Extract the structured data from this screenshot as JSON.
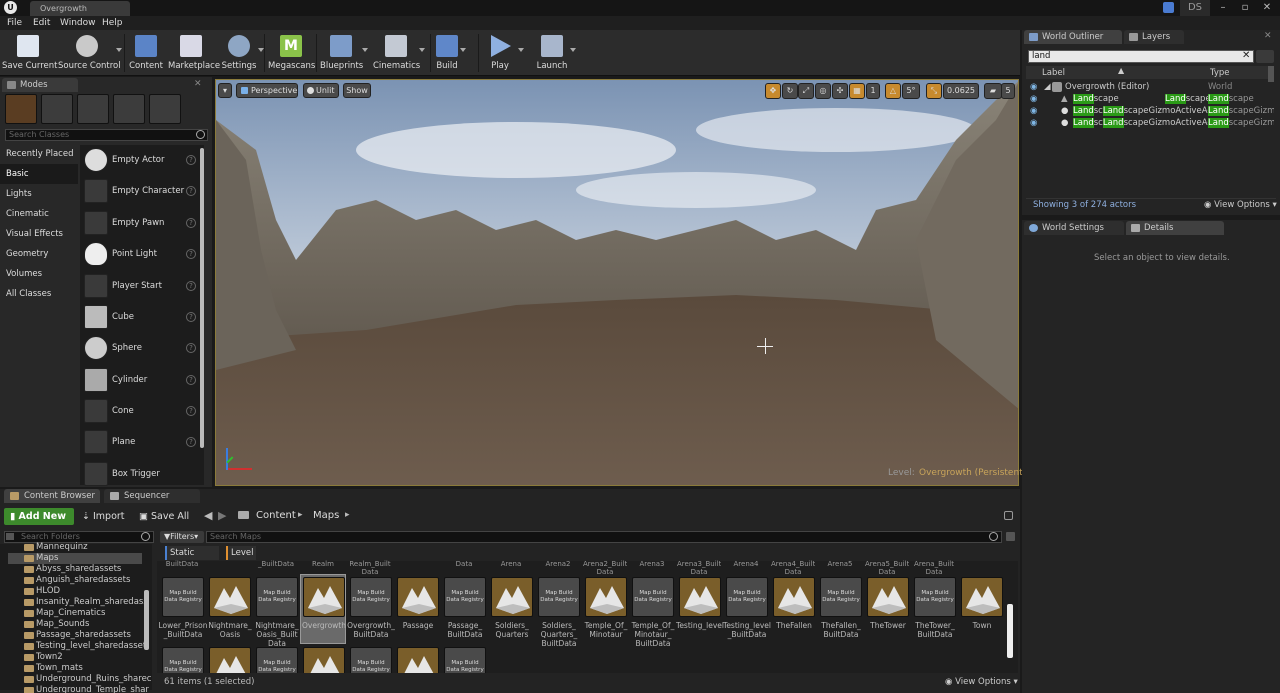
{
  "window": {
    "tab_title": "Overgrowth",
    "user_badge": "DS",
    "logo": "U"
  },
  "menu": [
    "File",
    "Edit",
    "Window",
    "Help"
  ],
  "toolbar": {
    "items": [
      {
        "label": "Save Current",
        "icon": "save-icon"
      },
      {
        "label": "Source Control",
        "icon": "source-control-icon"
      },
      {
        "label": "Content",
        "icon": "content-icon"
      },
      {
        "label": "Marketplace",
        "icon": "marketplace-icon"
      },
      {
        "label": "Settings",
        "icon": "settings-icon"
      },
      {
        "label": "Megascans",
        "icon": "megascans-icon"
      },
      {
        "label": "Blueprints",
        "icon": "blueprints-icon"
      },
      {
        "label": "Cinematics",
        "icon": "cinematics-icon"
      },
      {
        "label": "Build",
        "icon": "build-icon"
      },
      {
        "label": "Play",
        "icon": "play-icon"
      },
      {
        "label": "Launch",
        "icon": "launch-icon"
      }
    ]
  },
  "modes": {
    "tab": "Modes",
    "search_placeholder": "Search Classes",
    "categories": [
      "Recently Placed",
      "Basic",
      "Lights",
      "Cinematic",
      "Visual Effects",
      "Geometry",
      "Volumes",
      "All Classes"
    ],
    "selected_category": "Basic",
    "items": [
      "Empty Actor",
      "Empty Character",
      "Empty Pawn",
      "Point Light",
      "Player Start",
      "Cube",
      "Sphere",
      "Cylinder",
      "Cone",
      "Plane",
      "Box Trigger"
    ]
  },
  "viewport": {
    "perspective": "Perspective",
    "lit": "Unlit",
    "show": "Show",
    "grid_snap": "1",
    "rotation_snap": "5°",
    "scale_snap": "0.0625",
    "camera_speed": "5",
    "level_label": "Level:",
    "level_name": "Overgrowth (Persistent)"
  },
  "outliner": {
    "tabs": [
      "World Outliner",
      "Layers"
    ],
    "search_value": "land",
    "col_label": "Label",
    "col_type": "Type",
    "rows": [
      {
        "label": "Overgrowth (Editor)",
        "type": "World"
      },
      {
        "pre": "",
        "hl": "Land",
        "post": "scape",
        "type_hl": "Land",
        "type": "Landscape",
        "type_rest": "scape"
      },
      {
        "pre": "",
        "hl": "Land",
        "post": "sc",
        "hl2": "Land",
        "post2": "scapeGizmoActiveActor",
        "type_hl": "Land",
        "type_rest": "scapeGizmo"
      },
      {
        "pre": "",
        "hl": "Land",
        "post": "sc",
        "hl2": "Land",
        "post2": "scapeGizmoActiveActor",
        "type_hl": "Land",
        "type_rest": "scapeGizmo"
      }
    ],
    "status": "Showing 3 of 274 actors",
    "view_options": "View Options"
  },
  "details": {
    "tabs": [
      "World Settings",
      "Details"
    ],
    "empty_message": "Select an object to view details."
  },
  "content_browser": {
    "tabs": [
      "Content Browser",
      "Sequencer"
    ],
    "add_new": "Add New",
    "import": "Import",
    "save_all": "Save All",
    "path": [
      "Content",
      "Maps"
    ],
    "search_folders_placeholder": "Search Folders",
    "filters": "Filters",
    "search_maps_placeholder": "Search Maps",
    "filter_chips": [
      "Static Mesh",
      "Level"
    ],
    "folders": [
      "Mannequinz",
      "Maps",
      "Abyss_sharedassets",
      "Anguish_sharedassets",
      "HLOD",
      "Insanity_Realm_sharedass",
      "Map_Cinematics",
      "Map_Sounds",
      "Passage_sharedassets",
      "Testing_level_sharedasset",
      "Town2",
      "Town_mats",
      "Underground_Ruins_sharec",
      "Underground_Temple_shar"
    ],
    "top_row_clipped": [
      "BuiltData",
      "",
      "_BuiltData",
      "Realm",
      "Realm_Built Data",
      "",
      "Data",
      "Arena",
      "Arena2",
      "Arena2_Built Data",
      "Arena3",
      "Arena3_Built Data",
      "Arena4",
      "Arena4_Built Data",
      "Arena5",
      "Arena5_Built Data",
      "Arena_Built Data",
      ""
    ],
    "assets": [
      {
        "name": "Lower_Prison _BuiltData",
        "kind": "reg"
      },
      {
        "name": "Nightmare_ Oasis",
        "kind": "map"
      },
      {
        "name": "Nightmare_ Oasis_Built Data",
        "kind": "reg"
      },
      {
        "name": "Overgrowth",
        "kind": "map-sel"
      },
      {
        "name": "Overgrowth_ BuiltData",
        "kind": "reg"
      },
      {
        "name": "Passage",
        "kind": "map"
      },
      {
        "name": "Passage_ BuiltData",
        "kind": "reg"
      },
      {
        "name": "Soldiers_ Quarters",
        "kind": "map"
      },
      {
        "name": "Soldiers_ Quarters_ BuiltData",
        "kind": "reg"
      },
      {
        "name": "Temple_Of_ Minotaur",
        "kind": "map"
      },
      {
        "name": "Temple_Of_ Minotaur_ BuiltData",
        "kind": "reg"
      },
      {
        "name": "Testing_level",
        "kind": "map"
      },
      {
        "name": "Testing_level _BuiltData",
        "kind": "reg"
      },
      {
        "name": "TheFallen",
        "kind": "map"
      },
      {
        "name": "TheFallen_ BuiltData",
        "kind": "reg"
      },
      {
        "name": "TheTower",
        "kind": "map"
      },
      {
        "name": "TheTower_ BuiltData",
        "kind": "reg"
      },
      {
        "name": "Town",
        "kind": "map"
      }
    ],
    "registry_label": "Map Build Data Registry",
    "status": "61 items (1 selected)",
    "view_options": "View Options"
  }
}
